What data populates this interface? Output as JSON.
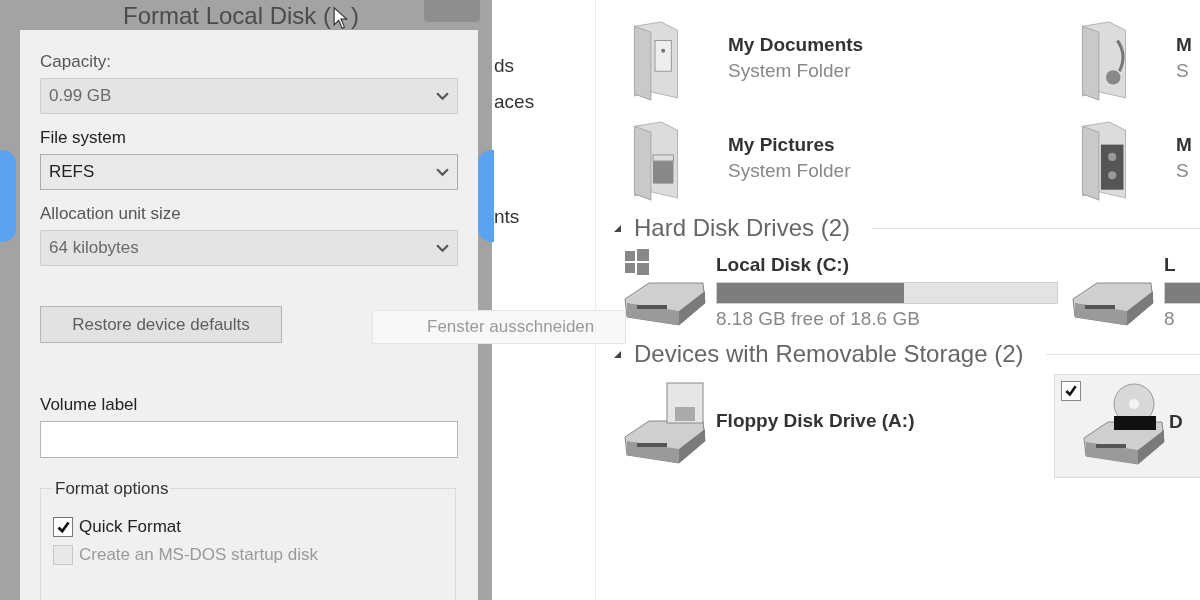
{
  "dialog": {
    "title": "Format Local Disk (",
    "title_end": ")",
    "fields": [
      {
        "label": "Capacity:",
        "value": "0.99 GB",
        "disabled": true
      },
      {
        "label": "File system",
        "value": "REFS",
        "disabled": false
      },
      {
        "label": "Allocation unit size",
        "value": "64 kilobytes",
        "disabled": true
      }
    ],
    "restore_button": {
      "label": "Restore device defaults",
      "disabled": true
    },
    "volume_label": {
      "label": "Volume label"
    },
    "format_options": {
      "title": "Format options",
      "options": [
        {
          "label": "Quick Format",
          "checked": true,
          "disabled": false
        },
        {
          "label": "Create an MS-DOS startup disk",
          "checked": false,
          "disabled": true
        }
      ]
    }
  },
  "sidebar": {
    "items": [
      "ds",
      "aces",
      "nts"
    ]
  },
  "tooltip": "Fenster ausschneiden",
  "explorer": {
    "folders": [
      {
        "kind": "documents",
        "name": "My Documents",
        "subtitle": "System Folder"
      },
      {
        "kind": "music",
        "name": "M",
        "subtitle": "S"
      },
      {
        "kind": "pictures",
        "name": "My Pictures",
        "subtitle": "System Folder"
      },
      {
        "kind": "video",
        "name": "M",
        "subtitle": "S"
      }
    ],
    "groups": [
      {
        "title": "Hard Disk Drives (2)",
        "expanded": true,
        "items": [
          {
            "kind": "windows-disk",
            "name": "Local Disk (C:)",
            "level": 0.55,
            "detail": "8.18 GB free of 18.6 GB",
            "selected": false
          },
          {
            "kind": "disk",
            "name": "L",
            "level": 0.5,
            "detail": "8",
            "selected": false
          }
        ]
      },
      {
        "title": "Devices with Removable Storage (2)",
        "expanded": true,
        "items": [
          {
            "kind": "floppy",
            "name": "Floppy Disk Drive (A:)",
            "selected": false
          },
          {
            "kind": "dvd",
            "name": "D",
            "selected": true,
            "checked": true
          }
        ]
      }
    ]
  }
}
